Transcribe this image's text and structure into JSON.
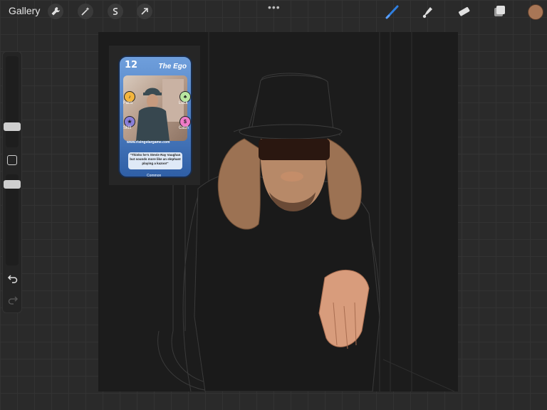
{
  "toolbar": {
    "gallery_label": "Gallery",
    "left_tools": [
      "wrench-icon",
      "magic-wand-icon",
      "selection-icon",
      "transform-arrow-icon"
    ],
    "more_label": "•••",
    "right_tools": [
      "brush-icon",
      "smudge-icon",
      "eraser-icon",
      "layers-icon"
    ],
    "active_tool": "brush-icon",
    "current_color": "#a87656",
    "active_color": "#2f7fe0"
  },
  "card": {
    "number": "12",
    "title": "The Ego",
    "stats": [
      "Fans",
      "Luck",
      "Skill",
      "Cash"
    ],
    "url": "www.risingstargame.com",
    "quote": "\"Thinks he's Stevie Ray Vaughan but sounds more like an elephant playing a kazoo!\"",
    "rarity": "Common"
  }
}
